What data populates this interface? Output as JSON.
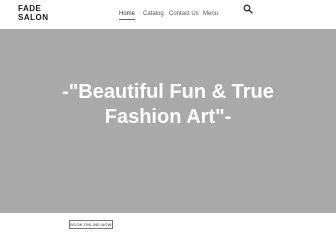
{
  "header": {
    "logo_line1": "FADE",
    "logo_line2": "SALON",
    "nav": [
      {
        "label": "Home",
        "active": true
      },
      {
        "label": "Catalog",
        "active": false
      },
      {
        "label": "Contact Us",
        "active": false
      },
      {
        "label": "Menu",
        "active": false
      }
    ],
    "search_icon": "search-icon"
  },
  "hero": {
    "background_color": "#a9a9a9",
    "title_line1": "-\"Beautiful Fun & True",
    "title_line2": "Fashion Art\"-"
  },
  "cta": {
    "label": "BOOK ONLINE NOW"
  }
}
